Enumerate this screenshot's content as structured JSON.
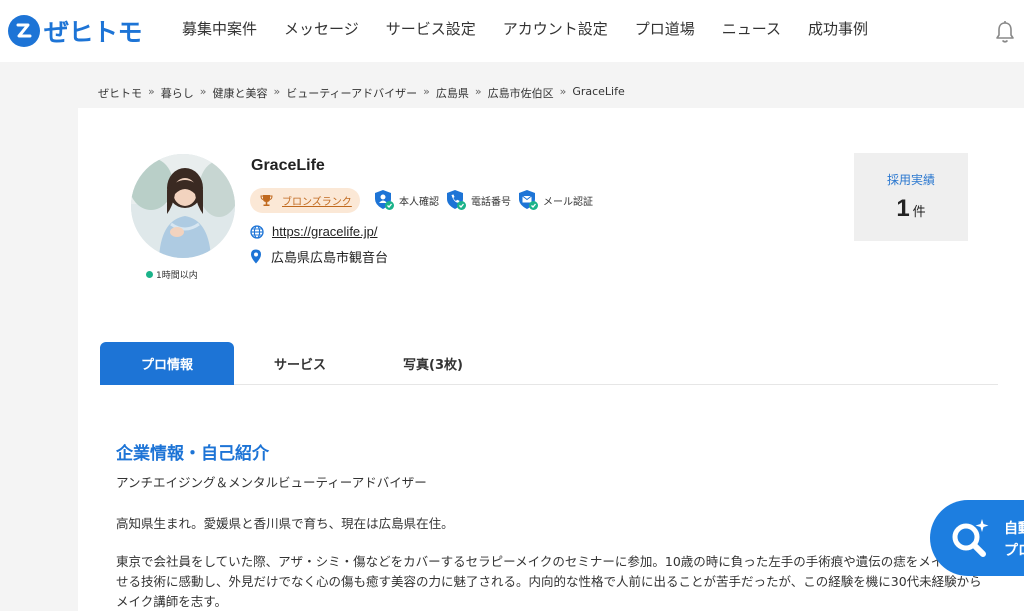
{
  "header": {
    "logo_text": "ぜヒトモ",
    "nav": [
      "募集中案件",
      "メッセージ",
      "サービス設定",
      "アカウント設定",
      "プロ道場",
      "ニュース",
      "成功事例"
    ]
  },
  "breadcrumb": [
    "ぜヒトモ",
    "暮らし",
    "健康と美容",
    "ビューティーアドバイザー",
    "広島県",
    "広島市佐伯区",
    "GraceLife"
  ],
  "profile": {
    "name": "GraceLife",
    "rank": "ブロンズランク",
    "verifications": [
      "本人確認",
      "電話番号",
      "メール認証"
    ],
    "url": "https://gracelife.jp/",
    "location": "広島県広島市観音台",
    "status": "1時間以内",
    "stats_label": "採用実績",
    "stats_value": "1",
    "stats_unit": "件"
  },
  "tabs": [
    "プロ情報",
    "サービス",
    "写真(3枚)"
  ],
  "section": {
    "title": "企業情報・自己紹介",
    "p1": "アンチエイジング＆メンタルビューティーアドバイザー",
    "p2": "高知県生まれ。愛媛県と香川県で育ち、現在は広島県在住。",
    "p3": "東京で会社員をしていた際、アザ・シミ・傷などをカバーするセラピーメイクのセミナーに参加。10歳の時に負った左手の手術痕や遺伝の痣をメイクで隠せる技術に感動し、外見だけでなく心の傷も癒す美容の力に魅了される。内向的な性格で人前に出ることが苦手だったが、この経験を機に30代未経験からメイク講師を志す。"
  },
  "fab": {
    "line1": "自動",
    "line2": "プロ"
  },
  "colors": {
    "brand": "#1d74d6",
    "rank_bg": "#fbe8d6",
    "rank_text": "#c0691e",
    "online": "#1bb38a"
  }
}
